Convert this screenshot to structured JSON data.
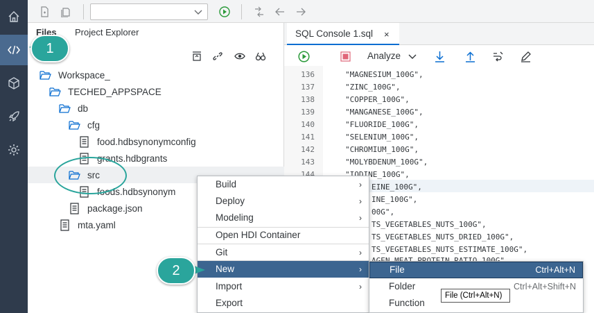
{
  "activity_bar": {
    "items": [
      {
        "icon": "home-icon"
      },
      {
        "icon": "code-icon",
        "active": true
      },
      {
        "icon": "cube-icon"
      },
      {
        "icon": "rocket-icon"
      },
      {
        "icon": "gear-icon"
      }
    ]
  },
  "top_toolbar": {
    "run_config_value": ""
  },
  "files_panel": {
    "tabs": [
      "Files",
      "Project Explorer"
    ],
    "tree": [
      {
        "label": "Workspace_",
        "type": "folder"
      },
      {
        "label": "TECHED_APPSPACE",
        "type": "folder"
      },
      {
        "label": "db",
        "type": "folder"
      },
      {
        "label": "cfg",
        "type": "folder"
      },
      {
        "label": "food.hdbsynonymconfig",
        "type": "file"
      },
      {
        "label": "grants.hdbgrants",
        "type": "file"
      },
      {
        "label": "src",
        "type": "folder"
      },
      {
        "label": "foods.hdbsynonym",
        "type": "file"
      },
      {
        "label": "package.json",
        "type": "file"
      },
      {
        "label": "mta.yaml",
        "type": "file"
      }
    ]
  },
  "editor": {
    "tab_label": "SQL Console 1.sql",
    "tab_close": "×",
    "analyze_label": "Analyze",
    "line_numbers": [
      "136",
      "137",
      "138",
      "139",
      "140",
      "141",
      "142",
      "143",
      "144"
    ],
    "code_lines": [
      "\"MAGNESIUM_100G\",",
      "\"ZINC_100G\",",
      "\"COPPER_100G\",",
      "\"MANGANESE_100G\",",
      "\"FLUORIDE_100G\",",
      "\"SELENIUM_100G\",",
      "\"CHROMIUM_100G\",",
      "\"MOLYBDENUM_100G\",",
      "\"IODINE_100G\","
    ],
    "code_lines_partial": [
      "EINE_100G\",",
      "INE_100G\",",
      "00G\",",
      "TS_VEGETABLES_NUTS_100G\",",
      "TS_VEGETABLES_NUTS_DRIED_100G\",",
      "TS_VEGETABLES_NUTS_ESTIMATE_100G\",",
      "AGEN_MEAT_PROTEIN_RATIO_100G\""
    ]
  },
  "context_menu": {
    "items": [
      "Build",
      "Deploy",
      "Modeling",
      "Open HDI Container",
      "Git",
      "New",
      "Import",
      "Export"
    ],
    "submenu_arrow": "›"
  },
  "new_submenu": {
    "items": [
      {
        "label": "File",
        "shortcut": "Ctrl+Alt+N"
      },
      {
        "label": "Folder",
        "shortcut": "Ctrl+Alt+Shift+N"
      },
      {
        "label": "Function",
        "shortcut": ""
      }
    ]
  },
  "tooltip": "File (Ctrl+Alt+N)",
  "callouts": [
    "1",
    "2"
  ],
  "colors": {
    "activity_bar": "#2f3b4c",
    "accent": "#0a6ed1",
    "callout": "#2aa59c",
    "menu_highlight": "#3c6590",
    "run_green": "#2b9a3a",
    "stop_red": "#e0677a"
  }
}
